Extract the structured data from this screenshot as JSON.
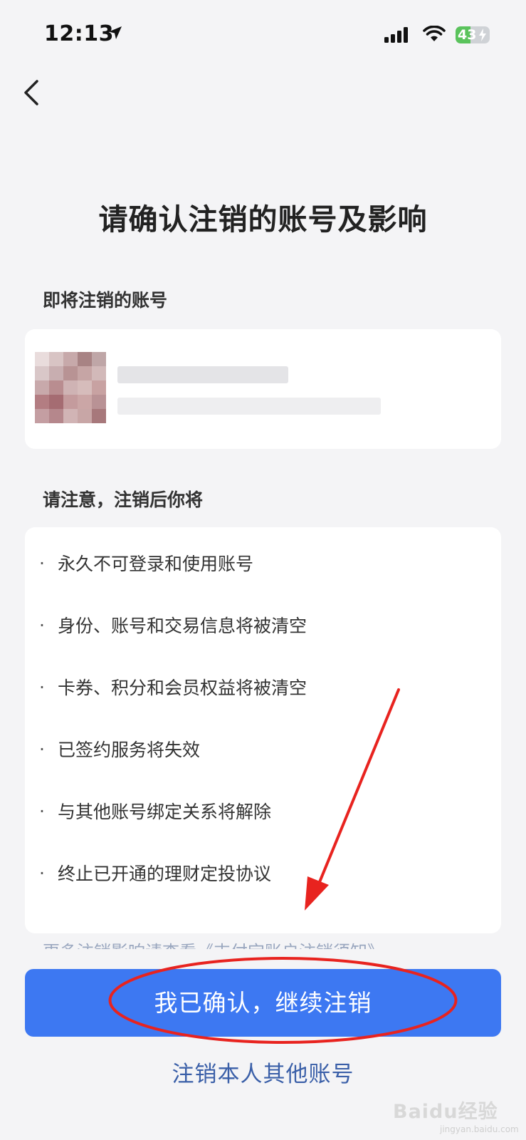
{
  "status_bar": {
    "time": "12:13",
    "battery": "43",
    "battery_level_percent": 43
  },
  "nav": {
    "back_icon": "chevron-left-icon"
  },
  "title": "请确认注销的账号及影响",
  "account_section": {
    "label": "即将注销的账号"
  },
  "impact_section": {
    "label": "请注意，注销后你将",
    "bullet": "·",
    "items": [
      "永久不可登录和使用账号",
      "身份、账号和交易信息将被清空",
      "卡券、积分和会员权益将被清空",
      "已签约服务将失效",
      "与其他账号绑定关系将解除",
      "终止已开通的理财定投协议"
    ],
    "more_text": "更多注销影响请查看《支付宝账户注销须知》"
  },
  "actions": {
    "confirm_label": "我已确认，继续注销",
    "other_accounts_label": "注销本人其他账号"
  },
  "watermark": {
    "main": "Baidu经验",
    "sub": "jingyan.baidu.com"
  },
  "colors": {
    "primary": "#3d78f2",
    "link": "#3a5fa8",
    "annotation": "#e8231f",
    "background": "#f4f4f6"
  }
}
